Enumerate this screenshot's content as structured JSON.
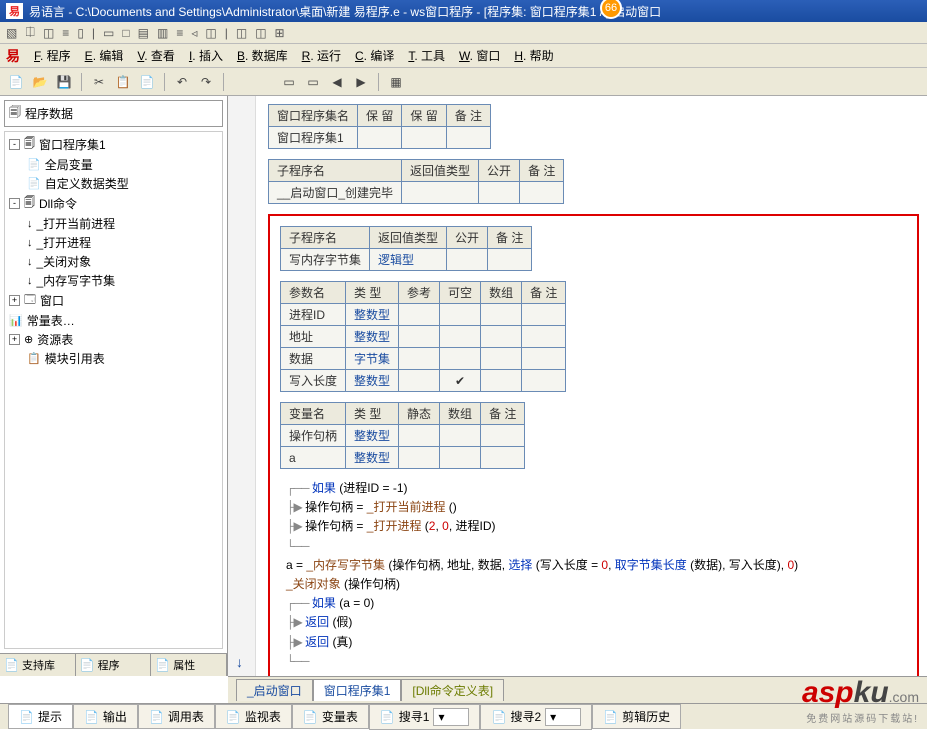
{
  "badge": "66",
  "title": "易语言 - C:\\Documents and Settings\\Administrator\\桌面\\新建 易程序.e -      ws窗口程序 - [程序集: 窗口程序集1 / _启动窗口",
  "smalltb": [
    "▧",
    "⎅",
    "◫",
    "≡",
    "▯",
    "|",
    "▭",
    "□",
    "▤",
    "▥",
    "≡",
    "◃",
    "◫",
    "|",
    "◫",
    "◫",
    "⊞"
  ],
  "menu": [
    {
      "u": "F",
      "t": ". 程序"
    },
    {
      "u": "E",
      "t": ". 编辑"
    },
    {
      "u": "V",
      "t": ". 查看"
    },
    {
      "u": "I",
      "t": ". 插入"
    },
    {
      "u": "B",
      "t": ". 数据库"
    },
    {
      "u": "R",
      "t": ". 运行"
    },
    {
      "u": "C",
      "t": ". 编译"
    },
    {
      "u": "T",
      "t": ". 工具"
    },
    {
      "u": "W",
      "t": ". 窗口"
    },
    {
      "u": "H",
      "t": ". 帮助"
    }
  ],
  "toolbar": [
    "📄",
    "📂",
    "💾",
    "|",
    "✂",
    "📋",
    "📄",
    "|",
    "↶",
    "↷",
    "|",
    "",
    "",
    "▭",
    "▭",
    "◀",
    "▶",
    "|",
    "▦"
  ],
  "tree_title": "程序数据",
  "tree": [
    {
      "lvl": 0,
      "toggle": "-",
      "ico": "🗐",
      "txt": "窗口程序集1"
    },
    {
      "lvl": 1,
      "toggle": "",
      "ico": "📄",
      "txt": "全局变量"
    },
    {
      "lvl": 1,
      "toggle": "",
      "ico": "📄",
      "txt": "自定义数据类型"
    },
    {
      "lvl": 0,
      "toggle": "-",
      "ico": "🗐",
      "txt": "Dll命令"
    },
    {
      "lvl": 1,
      "toggle": "",
      "ico": "↓",
      "txt": "_打开当前进程"
    },
    {
      "lvl": 1,
      "toggle": "",
      "ico": "↓",
      "txt": "_打开进程"
    },
    {
      "lvl": 1,
      "toggle": "",
      "ico": "↓",
      "txt": "_关闭对象"
    },
    {
      "lvl": 1,
      "toggle": "",
      "ico": "↓",
      "txt": "_内存写字节集"
    },
    {
      "lvl": 0,
      "toggle": "+",
      "ico": "🗔",
      "txt": "窗口"
    },
    {
      "lvl": 0,
      "toggle": "",
      "ico": "📊",
      "txt": "常量表…"
    },
    {
      "lvl": 0,
      "toggle": "+",
      "ico": "⊕",
      "txt": "资源表"
    },
    {
      "lvl": 1,
      "toggle": "",
      "ico": "📋",
      "txt": "模块引用表"
    }
  ],
  "left_tabs": [
    "支持库",
    "程序",
    "属性"
  ],
  "tbl1_h": [
    "窗口程序集名",
    "保 留",
    "保 留",
    "备 注"
  ],
  "tbl1_r": [
    "窗口程序集1",
    "",
    "",
    ""
  ],
  "tbl2_h": [
    "子程序名",
    "返回值类型",
    "公开",
    "备 注"
  ],
  "tbl2_r": [
    "__启动窗口_创建完毕",
    "",
    "",
    ""
  ],
  "sub_h": [
    "子程序名",
    "返回值类型",
    "公开",
    "备 注"
  ],
  "sub_r": [
    "写内存字节集",
    "逻辑型",
    "",
    ""
  ],
  "param_h": [
    "参数名",
    "类 型",
    "参考",
    "可空",
    "数组",
    "备 注"
  ],
  "params": [
    [
      "进程ID",
      "整数型",
      "",
      "",
      "",
      ""
    ],
    [
      "地址",
      "整数型",
      "",
      "",
      "",
      ""
    ],
    [
      "数据",
      "字节集",
      "",
      "",
      "",
      ""
    ],
    [
      "写入长度",
      "整数型",
      "",
      "✔",
      "",
      ""
    ]
  ],
  "var_h": [
    "变量名",
    "类 型",
    "静态",
    "数组",
    "备 注"
  ],
  "vars": [
    [
      "操作句柄",
      "整数型",
      "",
      "",
      ""
    ],
    [
      "a",
      "整数型",
      "",
      "",
      ""
    ]
  ],
  "code": {
    "l1a": "如果",
    "l1b": "(进程ID = -1)",
    "l2a": "操作句柄 = ",
    "l2b": "_打开当前进程",
    "l2c": " ()",
    "l3a": "操作句柄 = ",
    "l3b": "_打开进程",
    "l3c": " (",
    "l3d": "2",
    "l3e": ", ",
    "l3f": "0",
    "l3g": ", 进程ID)",
    "l4a": "a = ",
    "l4b": "_内存写字节集",
    "l4c": " (操作句柄, 地址, 数据, ",
    "l4d": "选择",
    "l4e": " (写入长度 = ",
    "l4f": "0",
    "l4g": ", ",
    "l4h": "取字节集长度",
    "l4i": " (数据), 写入长度), ",
    "l4j": "0",
    "l4k": ")",
    "l5a": "_关闭对象",
    "l5b": " (操作句柄)",
    "l6a": "如果",
    "l6b": "(a = 0)",
    "l7a": "返回",
    "l7b": "(假)",
    "l8a": "返回",
    "l8b": "(真)"
  },
  "editor_tabs": [
    "_启动窗口",
    "窗口程序集1",
    "[Dll命令定义表]"
  ],
  "bottom_tabs": [
    "提示",
    "输出",
    "调用表",
    "监视表",
    "变量表",
    "搜寻1",
    "搜寻2",
    "剪辑历史"
  ],
  "watermark": {
    "a": "asp",
    "b": "ku",
    "c": ".com",
    "d": "免费网站源码下载站!"
  }
}
